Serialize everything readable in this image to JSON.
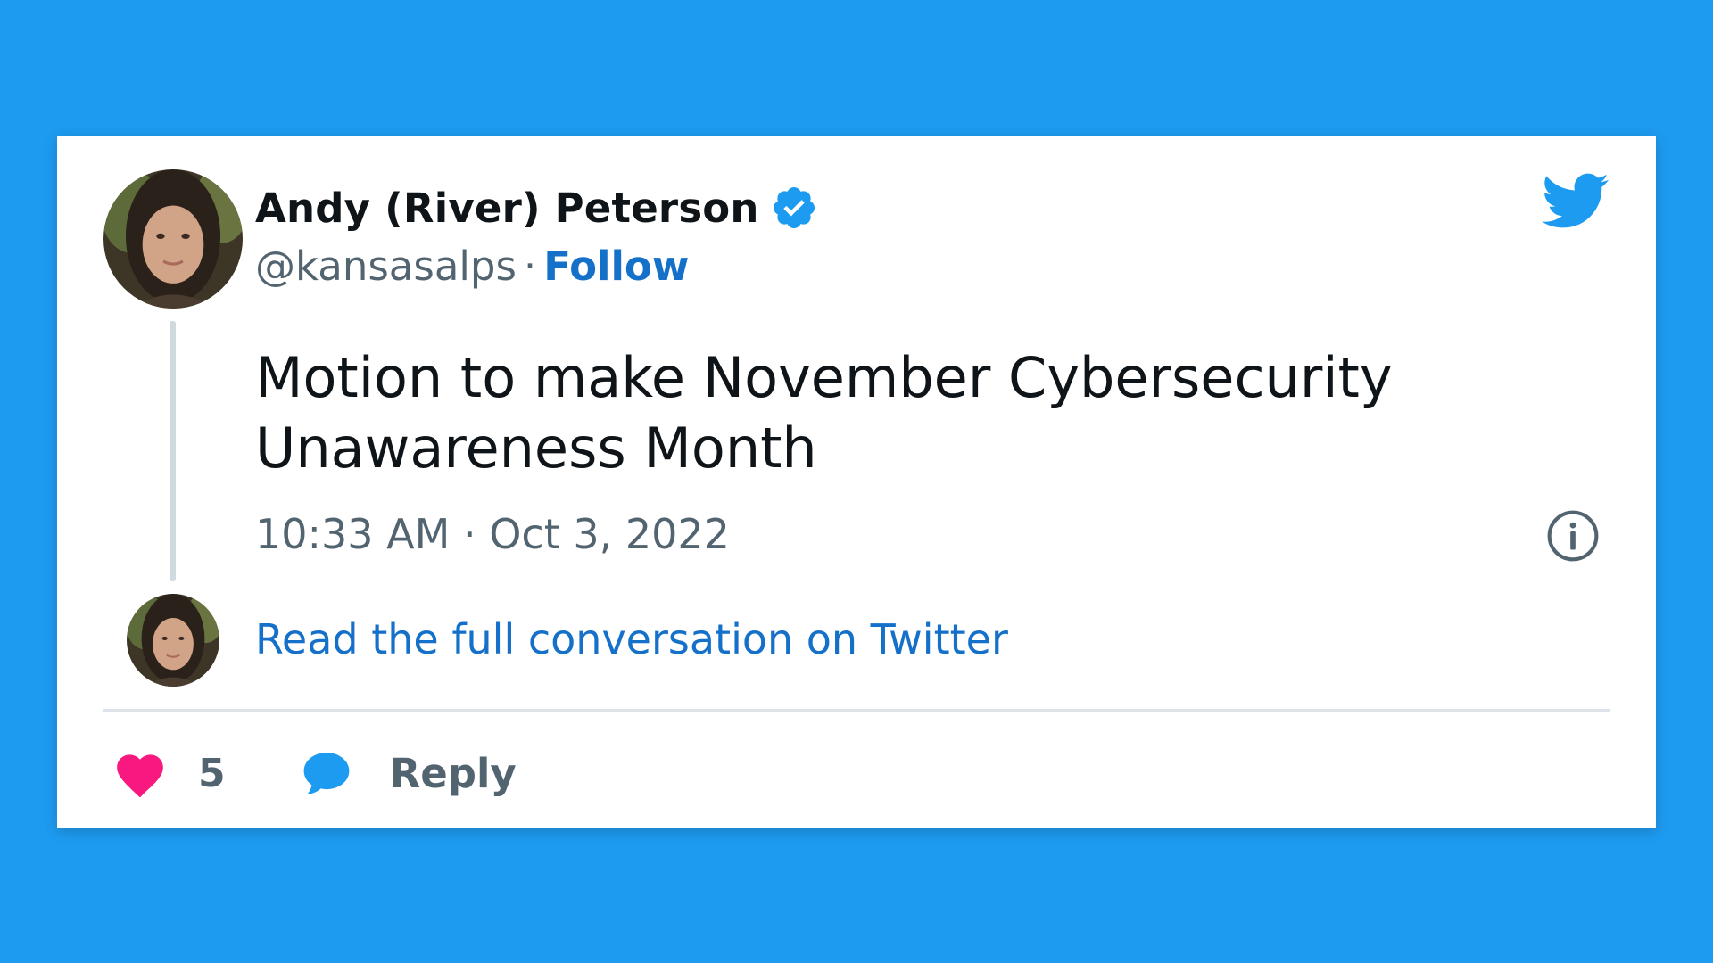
{
  "tweet": {
    "author": {
      "display_name": "Andy (River) Peterson",
      "handle": "@kansasalps",
      "separator": "·",
      "follow_label": "Follow",
      "verified": true,
      "avatar": "profile-photo"
    },
    "text": "Motion to make November Cybersecurity Unawareness Month",
    "timestamp": "10:33 AM · Oct 3, 2022",
    "read_more_label": "Read the full conversation on Twitter",
    "likes": "5",
    "reply_label": "Reply",
    "icons": {
      "brand": "twitter-bird-icon",
      "verified": "verified-badge-icon",
      "info": "info-icon",
      "like": "heart-icon",
      "reply": "speech-bubble-icon"
    }
  },
  "colors": {
    "background": "#1d9bf0",
    "card": "#ffffff",
    "link": "#1470c8",
    "brand": "#1d9bf0",
    "heart": "#f91880",
    "muted": "#536471",
    "text": "#0f1419"
  }
}
